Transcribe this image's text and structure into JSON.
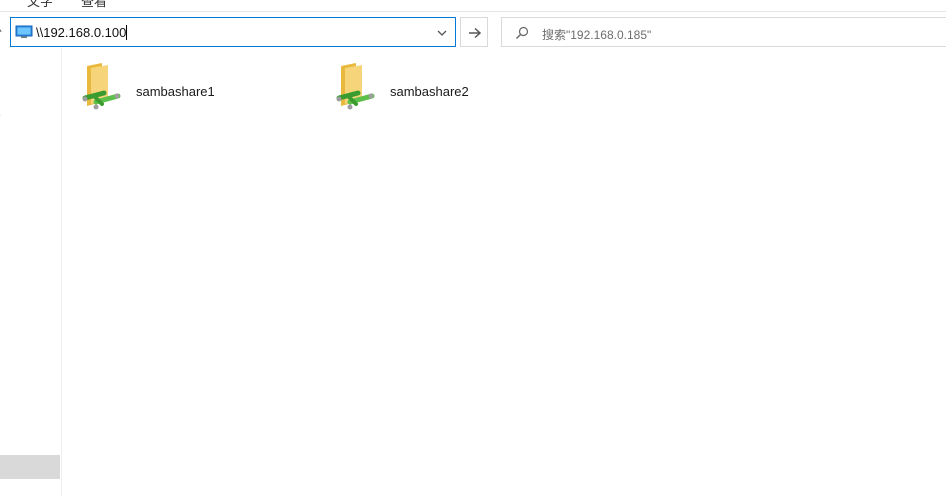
{
  "ribbon": {
    "tabs": [
      "文字",
      "查看"
    ]
  },
  "address": {
    "path": "\\\\192.168.0.100"
  },
  "search": {
    "placeholder": "搜索\"192.168.0.185\""
  },
  "nav_fragments": [
    "e",
    ")",
    ")",
    ")",
    ")"
  ],
  "items": [
    {
      "label": "sambashare1"
    },
    {
      "label": "sambashare2"
    }
  ],
  "colors": {
    "address_border": "#0078d7",
    "selected_nav": "#d9d9d9"
  }
}
